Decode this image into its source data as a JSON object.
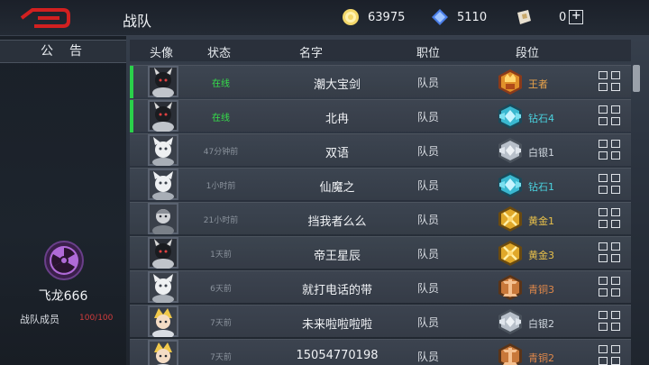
{
  "header": {
    "title": "战队",
    "gold": "63975",
    "diamonds": "5110",
    "tickets": "0",
    "plus_label": "+"
  },
  "sidebar": {
    "notice_tab": "公告",
    "team_name": "飞龙666",
    "member_label": "战队成员",
    "member_count": "100/100"
  },
  "table": {
    "columns": [
      "头像",
      "状态",
      "名字",
      "职位",
      "段位"
    ],
    "rows": [
      {
        "status": "在线",
        "name": "潮大宝剑",
        "role": "队员",
        "rank": "王者",
        "rank_color": "#e8a24a",
        "online": true,
        "rank_type": "king",
        "avatar": "dark"
      },
      {
        "status": "在线",
        "name": "北冉",
        "role": "队员",
        "rank": "钻石4",
        "rank_color": "#4ad3e0",
        "online": true,
        "rank_type": "diamond",
        "avatar": "dark"
      },
      {
        "status": "47分钟前",
        "name": "双语",
        "role": "队员",
        "rank": "白银1",
        "rank_color": "#cfd6de",
        "online": false,
        "rank_type": "silver",
        "avatar": "cat"
      },
      {
        "status": "1小时前",
        "name": "仙魔之",
        "role": "队员",
        "rank": "钻石1",
        "rank_color": "#4ad3e0",
        "online": false,
        "rank_type": "diamond",
        "avatar": "cat"
      },
      {
        "status": "21小时前",
        "name": "挡我者么么",
        "role": "队员",
        "rank": "黄金1",
        "rank_color": "#e8c04a",
        "online": false,
        "rank_type": "gold",
        "avatar": "grey"
      },
      {
        "status": "1天前",
        "name": "帝王星辰",
        "role": "队员",
        "rank": "黄金3",
        "rank_color": "#e8c04a",
        "online": false,
        "rank_type": "gold",
        "avatar": "dark"
      },
      {
        "status": "6天前",
        "name": "就打电话的带",
        "role": "队员",
        "rank": "青铜3",
        "rank_color": "#e0884a",
        "online": false,
        "rank_type": "bronze",
        "avatar": "cat"
      },
      {
        "status": "7天前",
        "name": "未来啦啦啦啦",
        "role": "队员",
        "rank": "白银2",
        "rank_color": "#cfd6de",
        "online": false,
        "rank_type": "silver",
        "avatar": "blonde"
      },
      {
        "status": "7天前",
        "name": "15054770198",
        "role": "队员",
        "rank": "青铜2",
        "rank_color": "#e0884a",
        "online": false,
        "rank_type": "bronze",
        "avatar": "blonde"
      }
    ]
  },
  "colors": {
    "online": "#35e04a",
    "accent_red": "#d22020"
  }
}
